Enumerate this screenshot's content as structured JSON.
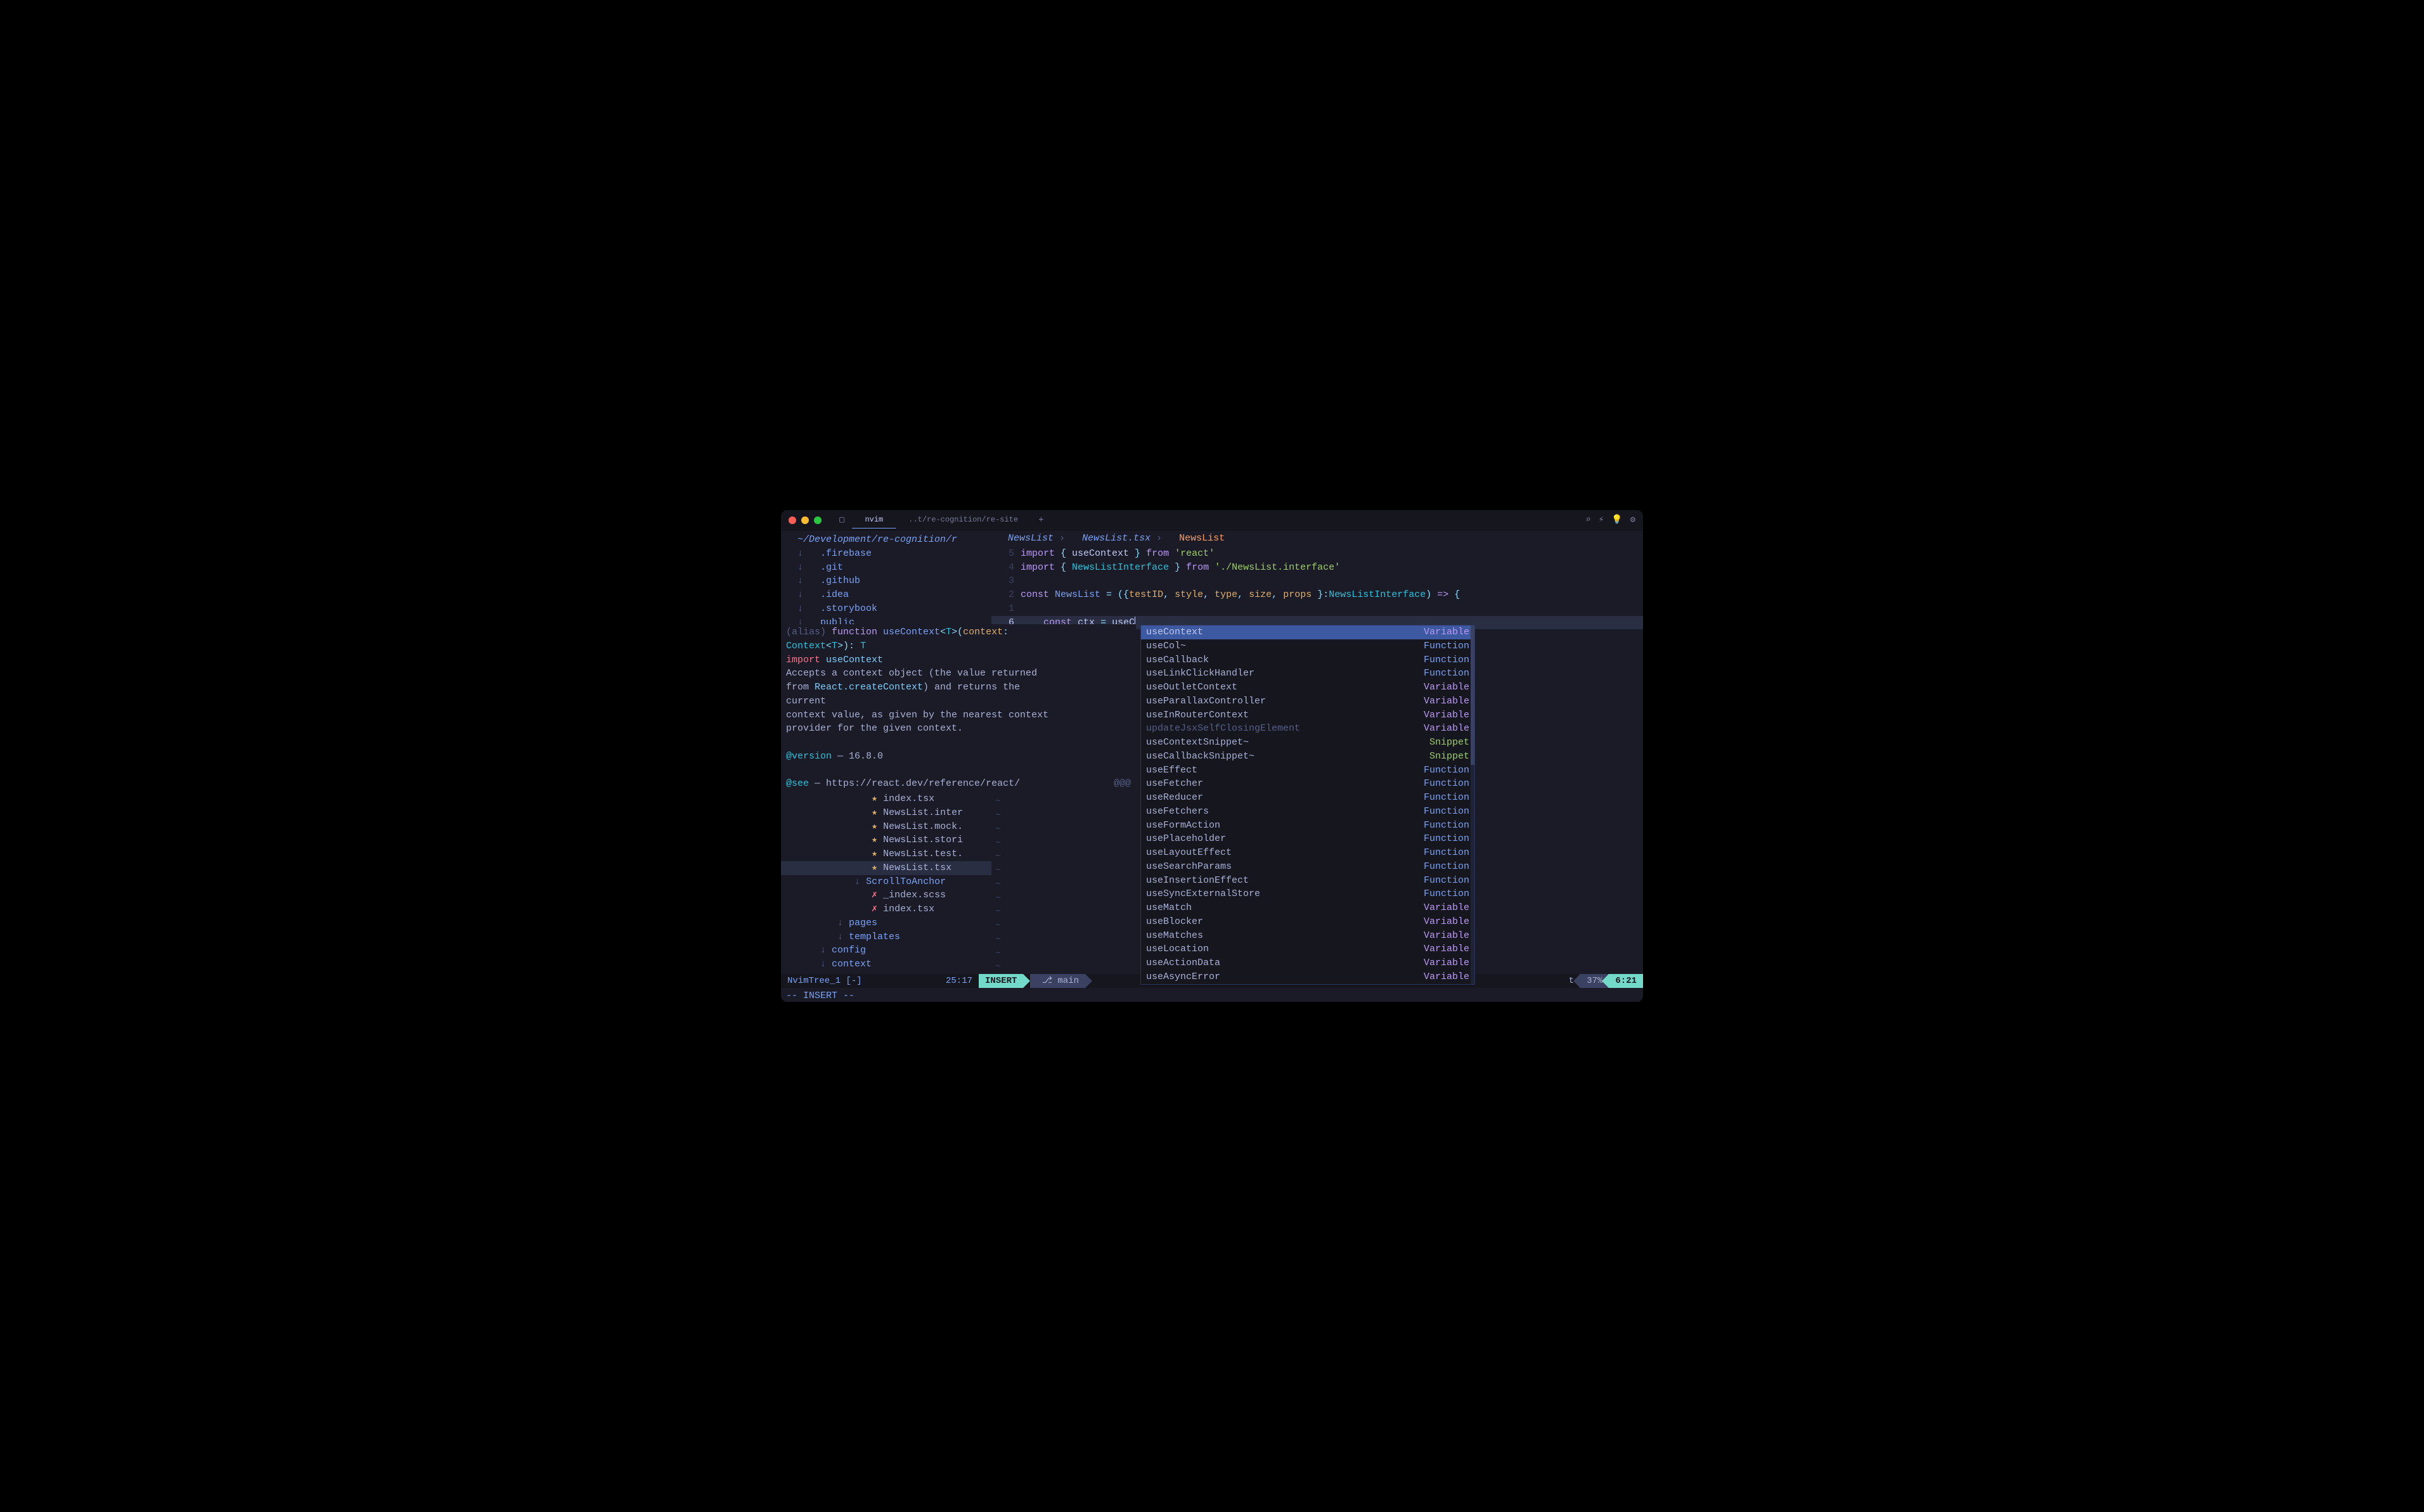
{
  "titlebar": {
    "tabs": [
      {
        "label": "nvim",
        "active": true
      },
      {
        "label": "..t/re-cognition/re-site",
        "active": false
      }
    ]
  },
  "tree": {
    "root": "~/Development/re-cognition/r",
    "top_items": [
      {
        "arrow": "↓",
        "indent": 1,
        "name": ".firebase",
        "kind": "folder"
      },
      {
        "arrow": "↓",
        "indent": 1,
        "name": ".git",
        "kind": "folder"
      },
      {
        "arrow": "↓",
        "indent": 1,
        "name": ".github",
        "kind": "folder"
      },
      {
        "arrow": "↓",
        "indent": 1,
        "name": ".idea",
        "kind": "folder"
      },
      {
        "arrow": "↓",
        "indent": 1,
        "name": ".storybook",
        "kind": "folder"
      },
      {
        "arrow": "↓",
        "indent": 1,
        "name": "public",
        "kind": "folder"
      }
    ],
    "lower_items": [
      {
        "icon": "★",
        "indent": 5,
        "name": "index.tsx",
        "kind": "star"
      },
      {
        "icon": "★",
        "indent": 5,
        "name": "NewsList.inter",
        "kind": "star"
      },
      {
        "icon": "★",
        "indent": 5,
        "name": "NewsList.mock.",
        "kind": "star"
      },
      {
        "icon": "★",
        "indent": 5,
        "name": "NewsList.stori",
        "kind": "star"
      },
      {
        "icon": "★",
        "indent": 5,
        "name": "NewsList.test.",
        "kind": "star"
      },
      {
        "icon": "★",
        "indent": 5,
        "name": "NewsList.tsx",
        "kind": "star",
        "selected": true
      },
      {
        "icon": "↓",
        "indent": 4,
        "name": "ScrollToAnchor",
        "kind": "folder"
      },
      {
        "icon": "✗",
        "indent": 5,
        "name": "_index.scss",
        "kind": "x"
      },
      {
        "icon": "✗",
        "indent": 5,
        "name": "index.tsx",
        "kind": "x"
      },
      {
        "icon": "↓",
        "indent": 3,
        "name": "pages",
        "kind": "folder"
      },
      {
        "icon": "↓",
        "indent": 3,
        "name": "templates",
        "kind": "folder"
      },
      {
        "icon": "↓",
        "indent": 2,
        "name": "config",
        "kind": "folder"
      },
      {
        "icon": "↓",
        "indent": 2,
        "name": "context",
        "kind": "folder"
      }
    ]
  },
  "breadcrumb": {
    "folder": "NewsList",
    "file": "NewsList.tsx",
    "symbol": "NewsList"
  },
  "code": {
    "lines": [
      {
        "n": "5",
        "tokens": [
          {
            "t": "import",
            "c": "keyword"
          },
          {
            "t": " { ",
            "c": "punct"
          },
          {
            "t": "useContext",
            "c": "ident"
          },
          {
            "t": " } ",
            "c": "punct"
          },
          {
            "t": "from",
            "c": "keyword"
          },
          {
            "t": " ",
            "c": ""
          },
          {
            "t": "'react'",
            "c": "string"
          }
        ]
      },
      {
        "n": "4",
        "tokens": [
          {
            "t": "import",
            "c": "keyword"
          },
          {
            "t": " { ",
            "c": "punct"
          },
          {
            "t": "NewsListInterface",
            "c": "type"
          },
          {
            "t": " } ",
            "c": "punct"
          },
          {
            "t": "from",
            "c": "keyword"
          },
          {
            "t": " ",
            "c": ""
          },
          {
            "t": "'./NewsList.interface'",
            "c": "string"
          }
        ]
      },
      {
        "n": "3",
        "tokens": []
      },
      {
        "n": "2",
        "tokens": [
          {
            "t": "const",
            "c": "keyword"
          },
          {
            "t": " ",
            "c": ""
          },
          {
            "t": "NewsList",
            "c": "func"
          },
          {
            "t": " = ({",
            "c": "punct"
          },
          {
            "t": "testID",
            "c": "param"
          },
          {
            "t": ", ",
            "c": "punct"
          },
          {
            "t": "style",
            "c": "param"
          },
          {
            "t": ", ",
            "c": "punct"
          },
          {
            "t": "type",
            "c": "param"
          },
          {
            "t": ", ",
            "c": "punct"
          },
          {
            "t": "size",
            "c": "param"
          },
          {
            "t": ", ",
            "c": "punct"
          },
          {
            "t": "props",
            "c": "param"
          },
          {
            "t": " }:",
            "c": "punct"
          },
          {
            "t": "NewsListInterface",
            "c": "type"
          },
          {
            "t": ") ",
            "c": "punct"
          },
          {
            "t": "=>",
            "c": "keyword"
          },
          {
            "t": " {",
            "c": "punct"
          }
        ]
      },
      {
        "n": "1",
        "tokens": []
      },
      {
        "n": "6",
        "current": true,
        "tokens": [
          {
            "t": "    ",
            "c": ""
          },
          {
            "t": "const",
            "c": "keyword"
          },
          {
            "t": " ",
            "c": ""
          },
          {
            "t": "ctx",
            "c": "ident"
          },
          {
            "t": " = ",
            "c": "punct"
          },
          {
            "t": "useC",
            "c": "ident"
          },
          {
            "t": "|",
            "c": "cursor"
          }
        ]
      }
    ]
  },
  "hover": {
    "sig_parts": [
      {
        "t": "(alias) ",
        "c": "comment"
      },
      {
        "t": "function",
        "c": "keyword"
      },
      {
        "t": " ",
        "c": ""
      },
      {
        "t": "useContext",
        "c": "func"
      },
      {
        "t": "<",
        "c": "punct"
      },
      {
        "t": "T",
        "c": "type"
      },
      {
        "t": ">(",
        "c": "punct"
      },
      {
        "t": "context",
        "c": "param"
      },
      {
        "t": ":",
        "c": "punct"
      }
    ],
    "sig2_parts": [
      {
        "t": "Context",
        "c": "type"
      },
      {
        "t": "<",
        "c": "punct"
      },
      {
        "t": "T",
        "c": "type"
      },
      {
        "t": ">): ",
        "c": "punct"
      },
      {
        "t": "T",
        "c": "type"
      }
    ],
    "import_parts": [
      {
        "t": "import",
        "c": "red"
      },
      {
        "t": " ",
        "c": ""
      },
      {
        "t": "useContext",
        "c": "import"
      }
    ],
    "body": [
      "Accepts a context object (the value returned",
      "from React.createContext) and returns the",
      "current",
      "context value, as given by the nearest context",
      "provider for the given context."
    ],
    "version_label": "@version",
    "version_value": " — 16.8.0",
    "see_label": "@see",
    "see_value": " — https://react.dev/reference/react/",
    "see_suffix": "@@@",
    "react_create": "React.createContext"
  },
  "completion": {
    "items": [
      {
        "label": "useContext",
        "kind": "Variable",
        "selected": true,
        "hl": [
          0,
          4
        ]
      },
      {
        "label": "useCol~",
        "kind": "Function",
        "hl": [
          0,
          4
        ]
      },
      {
        "label": "useCallback",
        "kind": "Function",
        "hl": [
          0,
          4
        ]
      },
      {
        "label": "useLinkClickHandler",
        "kind": "Function",
        "hl": []
      },
      {
        "label": "useOutletContext",
        "kind": "Variable",
        "hl": []
      },
      {
        "label": "useParallaxController",
        "kind": "Variable",
        "hl": []
      },
      {
        "label": "useInRouterContext",
        "kind": "Variable",
        "hl": []
      },
      {
        "label": "updateJsxSelfClosingElement",
        "kind": "Variable",
        "dim": true
      },
      {
        "label": "useContextSnippet~",
        "kind": "Snippet",
        "hl": []
      },
      {
        "label": "useCallbackSnippet~",
        "kind": "Snippet",
        "hl": []
      },
      {
        "label": "useEffect",
        "kind": "Function",
        "hl": []
      },
      {
        "label": "useFetcher",
        "kind": "Function",
        "hl": []
      },
      {
        "label": "useReducer",
        "kind": "Function",
        "hl": []
      },
      {
        "label": "useFetchers",
        "kind": "Function",
        "hl": []
      },
      {
        "label": "useFormAction",
        "kind": "Function",
        "hl": []
      },
      {
        "label": "usePlaceholder",
        "kind": "Function",
        "hl": []
      },
      {
        "label": "useLayoutEffect",
        "kind": "Function",
        "hl": []
      },
      {
        "label": "useSearchParams",
        "kind": "Function",
        "hl": []
      },
      {
        "label": "useInsertionEffect",
        "kind": "Function",
        "hl": []
      },
      {
        "label": "useSyncExternalStore",
        "kind": "Function",
        "hl": []
      },
      {
        "label": "useMatch",
        "kind": "Variable",
        "hl": []
      },
      {
        "label": "useBlocker",
        "kind": "Variable",
        "hl": []
      },
      {
        "label": "useMatches",
        "kind": "Variable",
        "hl": []
      },
      {
        "label": "useLocation",
        "kind": "Variable",
        "hl": []
      },
      {
        "label": "useActionData",
        "kind": "Variable",
        "hl": []
      },
      {
        "label": "useAsyncError",
        "kind": "Variable",
        "hl": []
      }
    ]
  },
  "statusline": {
    "left_file": "NvimTree_1 [-]",
    "left_pos": "25:17",
    "mode": "INSERT",
    "branch": " main",
    "right_filetype": "t",
    "percent": "37%",
    "cursor": "6:21"
  },
  "cmdline": "-- INSERT --"
}
